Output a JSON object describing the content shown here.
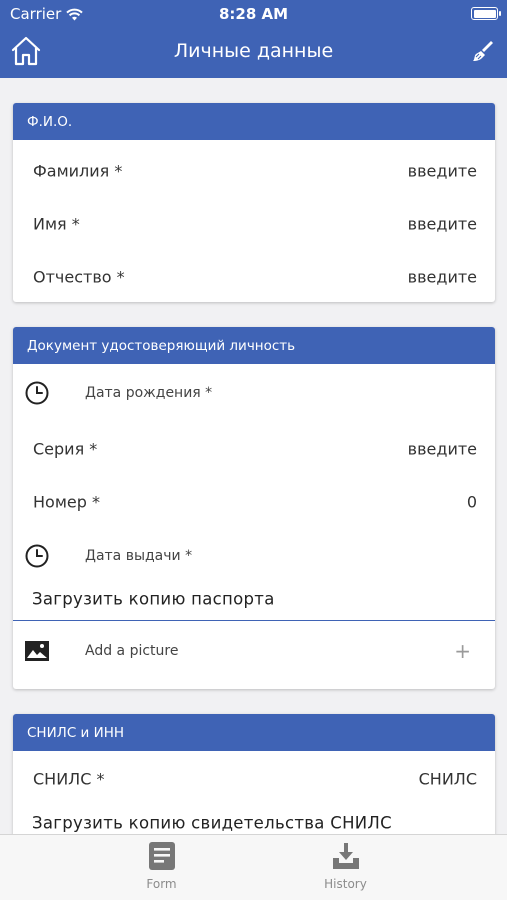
{
  "status_bar": {
    "carrier": "Carrier",
    "time": "8:28 AM"
  },
  "nav": {
    "title": "Личные данные",
    "home_icon": "home-icon",
    "clear_icon": "brush-icon"
  },
  "fio_card": {
    "header": "Ф.И.О.",
    "rows": [
      {
        "label": "Фамилия *",
        "value": "введите"
      },
      {
        "label": "Имя *",
        "value": "введите"
      },
      {
        "label": "Отчество *",
        "value": "введите"
      }
    ]
  },
  "doc_card": {
    "header": "Документ удостоверяющий личность",
    "birth_date": {
      "label": "Дата рождения *",
      "icon": "clock-icon"
    },
    "series": {
      "label": "Серия *",
      "value": "введите"
    },
    "number": {
      "label": "Номер *",
      "value": "0"
    },
    "issue_date": {
      "label": "Дата выдачи *",
      "icon": "clock-icon"
    },
    "upload_label": "Загрузить копию паспорта",
    "picture": {
      "label": "Add a picture",
      "plus": "+",
      "icon": "image-icon"
    }
  },
  "snils_card": {
    "header": "СНИЛС и ИНН",
    "snils": {
      "label": "СНИЛС *",
      "value": "СНИЛС"
    },
    "upload_label": "Загрузить копию свидетельства СНИЛС"
  },
  "tabbar": {
    "tabs": [
      {
        "label": "Form",
        "icon": "form-icon"
      },
      {
        "label": "History",
        "icon": "download-tray-icon"
      }
    ]
  },
  "colors": {
    "primary": "#3f63b5",
    "background": "#f1f1f3"
  }
}
